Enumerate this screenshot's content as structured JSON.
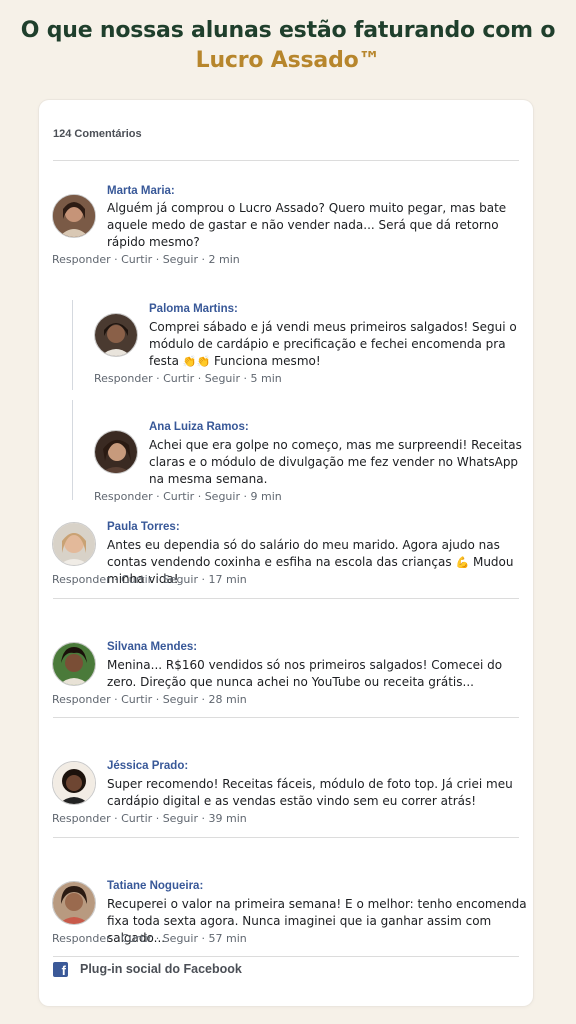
{
  "headline": {
    "line1": "O que nossas alunas estão faturando com o",
    "brand": "Lucro Assado™"
  },
  "colors": {
    "background": "#f6f1e8",
    "headline": "#1f3f2c",
    "brand": "#b7862c",
    "author": "#385898",
    "facebook": "#3b5998"
  },
  "comments_count": "124 Comentários",
  "action_labels": {
    "reply": "Responder",
    "like": "Curtir",
    "follow": "Seguir",
    "sep": "·"
  },
  "comments": [
    {
      "author": "Marta Maria:",
      "text": "Alguém já comprou o Lucro Assado? Quero muito pegar, mas bate aquele medo de gastar e não vender nada... Será que dá retorno rápido mesmo?",
      "time": "2 min",
      "avatar": "avatar-photo-icon"
    },
    {
      "author": "Paloma Martins:",
      "text": "Comprei sábado e já vendi meus primeiros salgados! Segui o módulo de cardápio e precificação e fechei encomenda pra festa",
      "emoji": "👏👏",
      "text_after": "Funciona mesmo!",
      "time": "5 min",
      "avatar": "avatar-photo-icon"
    },
    {
      "author": "Ana Luiza Ramos:",
      "text": "Achei que era golpe no começo, mas me surpreendi! Receitas claras e o módulo de divulgação me fez vender no WhatsApp na mesma semana.",
      "time": "9 min",
      "avatar": "avatar-photo-icon"
    },
    {
      "author": "Paula Torres:",
      "text": "Antes eu dependia só do salário do meu marido. Agora ajudo nas contas vendendo coxinha e esfiha na escola das crianças",
      "emoji": "💪",
      "text_after": "Mudou minha vida!",
      "time": "17 min",
      "avatar": "avatar-photo-icon"
    },
    {
      "author": "Silvana Mendes:",
      "text": "Menina... R$160 vendidos só nos primeiros salgados! Comecei do zero. Direção que nunca achei no YouTube ou receita grátis...",
      "time": "28 min",
      "avatar": "avatar-photo-icon"
    },
    {
      "author": "Jéssica Prado:",
      "text": "Super recomendo! Receitas fáceis, módulo de foto top. Já criei meu cardápio digital e as vendas estão vindo sem eu correr atrás!",
      "time": "39 min",
      "avatar": "avatar-photo-icon"
    },
    {
      "author": "Tatiane Nogueira:",
      "text": "Recuperei o valor na primeira semana! E o melhor: tenho encomenda fixa toda sexta agora. Nunca imaginei que ia ganhar assim com salgado...",
      "time": "57 min",
      "avatar": "avatar-photo-icon"
    }
  ],
  "footer": {
    "icon": "facebook-icon",
    "label": "Plug-in social do Facebook"
  }
}
